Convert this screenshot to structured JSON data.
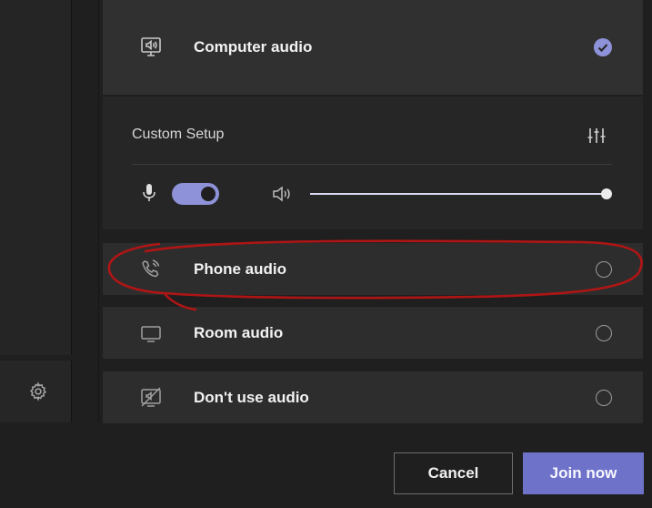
{
  "options": {
    "computer_audio": "Computer audio",
    "phone_audio": "Phone audio",
    "room_audio": "Room audio",
    "dont_use_audio": "Don't use audio"
  },
  "custom_setup": {
    "title": "Custom Setup",
    "mic_on": true,
    "speaker_volume": 1.0
  },
  "buttons": {
    "cancel": "Cancel",
    "join_now": "Join now"
  },
  "icons": {
    "computer": "computer-speaker-icon",
    "phone": "phone-icon",
    "room": "room-display-icon",
    "none": "no-audio-icon",
    "settings": "gear-icon",
    "mixer": "mixer-icon",
    "mic": "microphone-icon",
    "speaker": "speaker-icon",
    "selected": "checkmark-icon"
  },
  "colors": {
    "accent": "#8e92d8",
    "join_button": "#6e72c9",
    "annotation": "#b01515",
    "background": "#1f1f1f"
  }
}
